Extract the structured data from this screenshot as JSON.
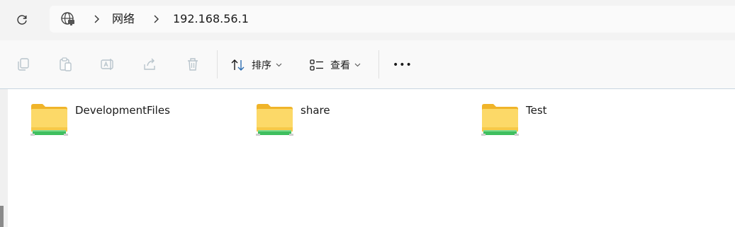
{
  "address_bar": {
    "location_icon": "network-globe-icon",
    "breadcrumb": [
      {
        "label": "网络"
      },
      {
        "label": "192.168.56.1"
      }
    ]
  },
  "toolbar": {
    "disabled_actions": [
      "copy-icon",
      "paste-icon",
      "rename-icon",
      "share-icon",
      "delete-icon"
    ],
    "sort_label": "排序",
    "view_label": "查看",
    "more_label": "•••"
  },
  "content": {
    "items": [
      {
        "name": "DevelopmentFiles",
        "type": "network-share-folder"
      },
      {
        "name": "share",
        "type": "network-share-folder"
      },
      {
        "name": "Test",
        "type": "network-share-folder"
      }
    ]
  },
  "colors": {
    "accent_blue": "#2b6cb0",
    "folder_yellow": "#f7c948",
    "share_green": "#3fbf5f",
    "disabled_icon": "#b8c4cc"
  }
}
